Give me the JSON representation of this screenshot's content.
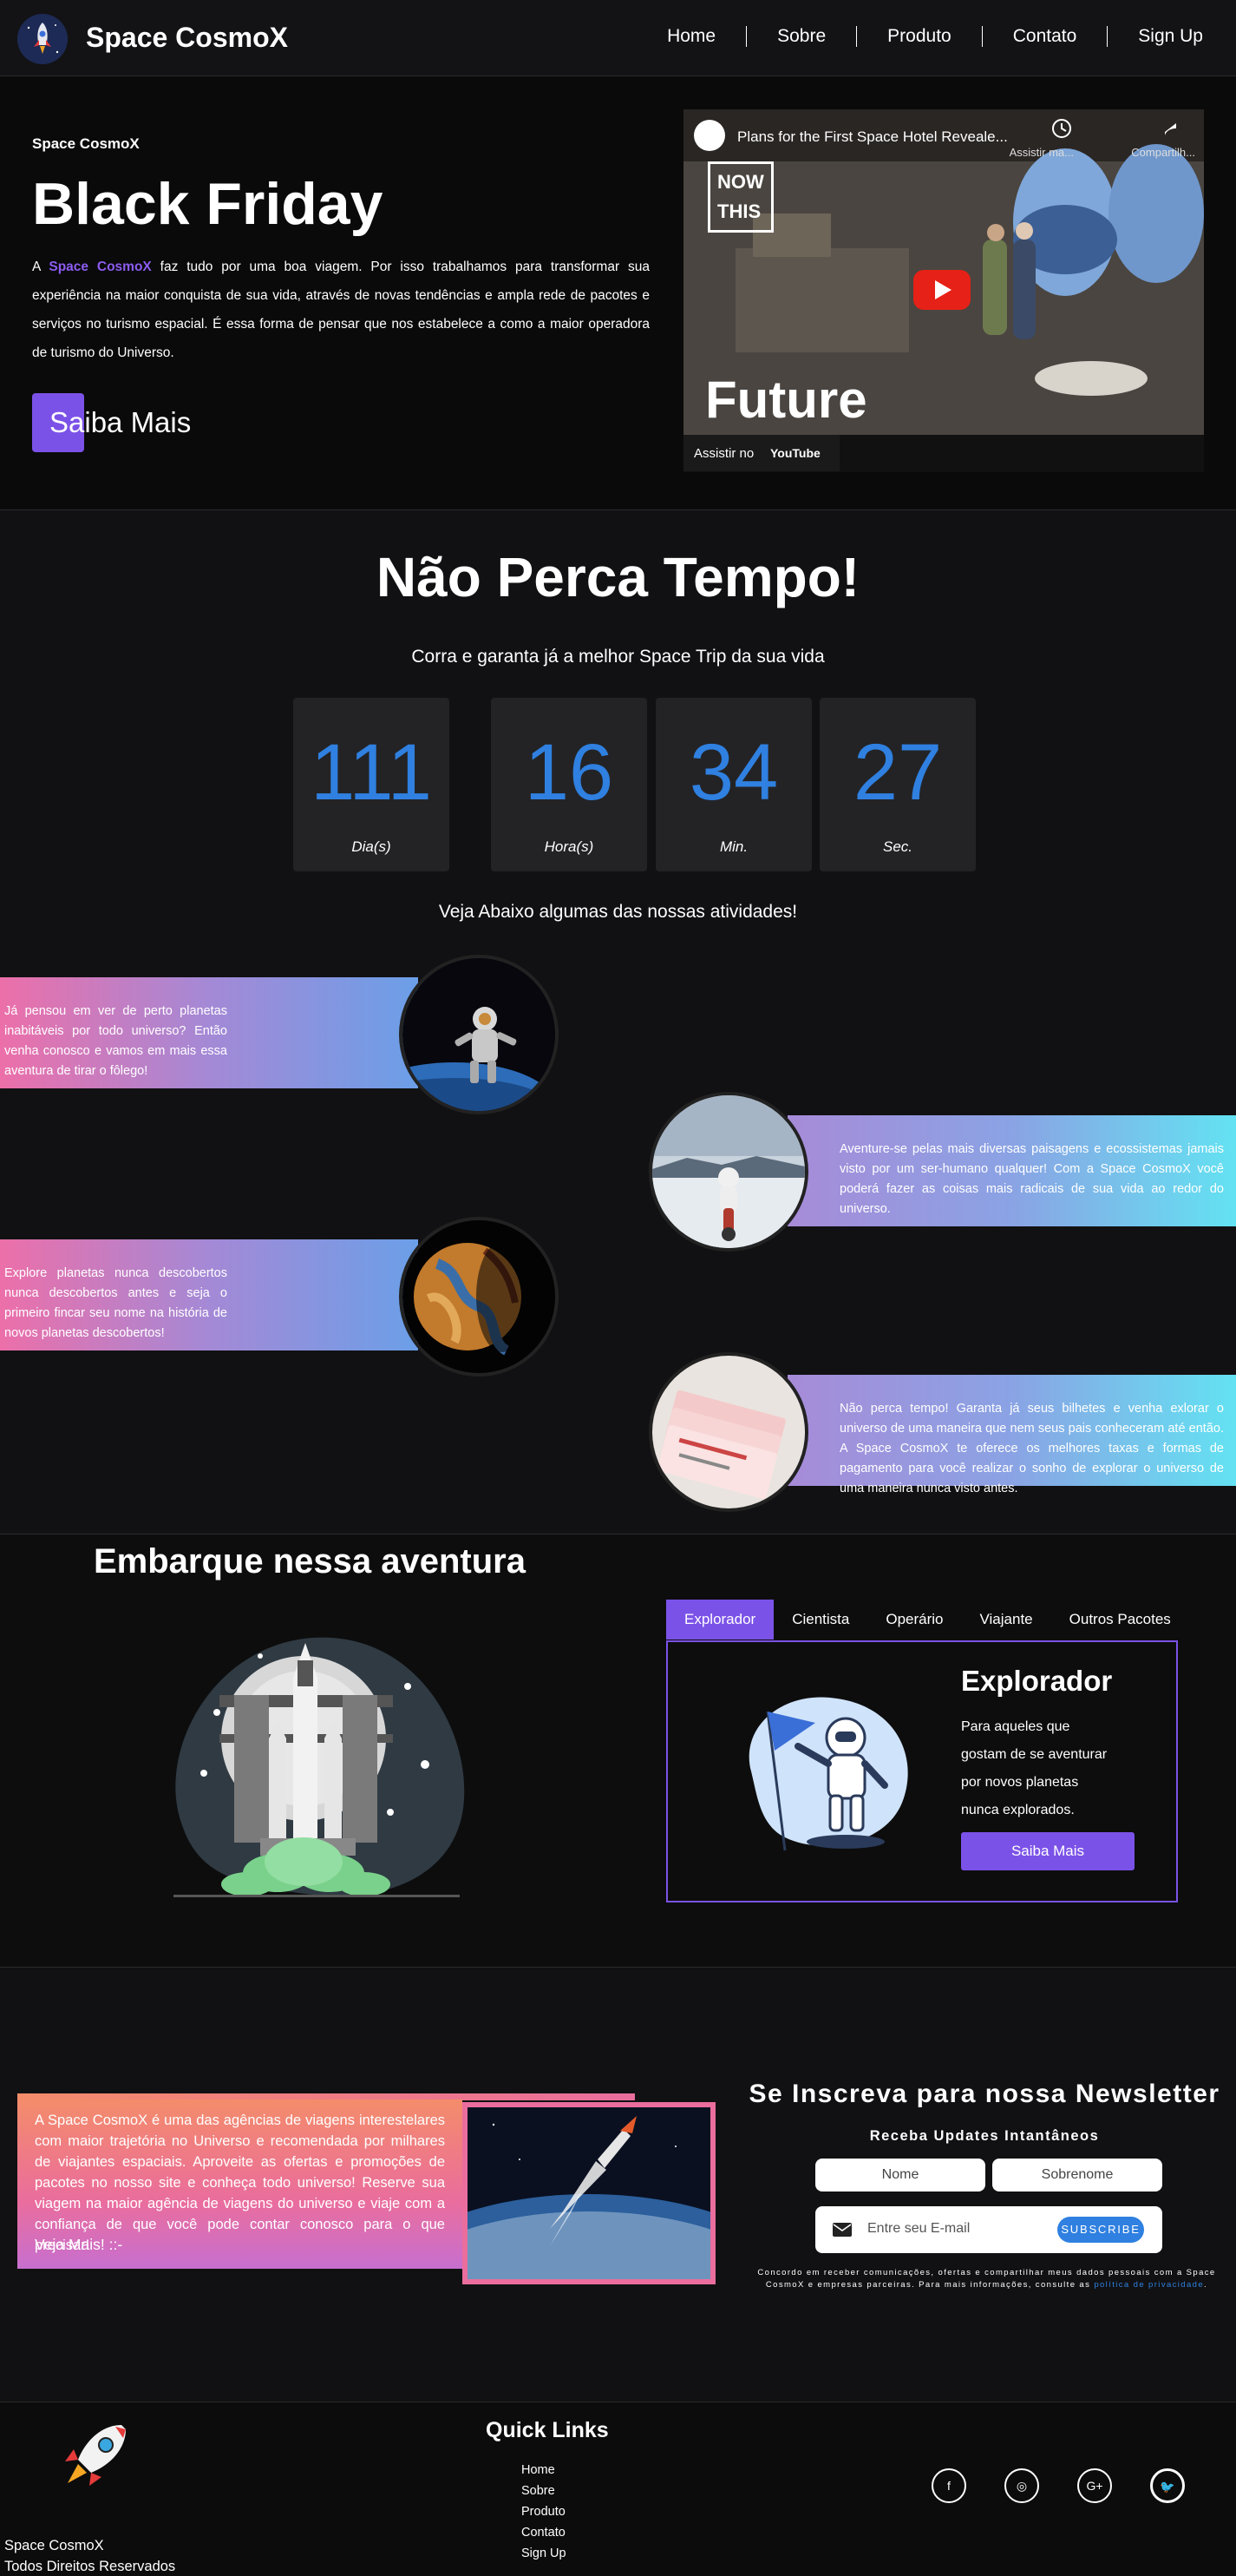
{
  "nav": {
    "brand": "Space CosmoX",
    "links": [
      "Home",
      "Sobre",
      "Produto",
      "Contato",
      "Sign Up"
    ]
  },
  "hero": {
    "kicker": "Space CosmoX",
    "title": "Black Friday",
    "text_prefix": "A ",
    "text_brand": "Space CosmoX",
    "text_body": " faz tudo por uma boa viagem. Por isso trabalhamos para transformar sua experiência na maior conquista de sua vida, através de novas tendências e ampla rede de pacotes e serviços no turismo espacial. É essa forma de pensar que nos estabelece a como a maior operadora de turismo do Universo.",
    "button": "Saiba Mais",
    "video": {
      "title": "Plans for the First Space Hotel Reveale...",
      "watch_later": "Assistir ma...",
      "share": "Compartilh...",
      "overlay_word": "Future",
      "channel_line1": "NOW",
      "channel_line2": "THIS",
      "watch_on": "Assistir no",
      "platform": "YouTube"
    }
  },
  "countdown": {
    "title": "Não Perca Tempo!",
    "subtitle": "Corra e garanta já a melhor Space Trip da sua vida",
    "units": [
      {
        "value": "111",
        "label": "Dia(s)"
      },
      {
        "value": "16",
        "label": "Hora(s)"
      },
      {
        "value": "34",
        "label": "Min."
      },
      {
        "value": "27",
        "label": "Sec."
      }
    ],
    "activities_intro": "Veja Abaixo algumas das nossas atividades!"
  },
  "activities": [
    "Já pensou em ver de perto planetas inabitáveis por todo universo? Então venha conosco e vamos em mais essa aventura de tirar o fôlego!",
    "Aventure-se pelas mais diversas paisagens e ecossistemas jamais visto por um ser-humano qualquer! Com a Space CosmoX você poderá fazer as coisas mais radicais de sua vida ao redor do universo.",
    "Explore planetas nunca descobertos nunca descobertos antes e seja o primeiro fincar seu nome na história de novos planetas descobertos!",
    "Não perca tempo! Garanta já seus bilhetes e venha exlorar o universo de uma maneira que nem seus pais conheceram até então. A Space CosmoX te oferece os melhores taxas e formas de pagamento para você realizar o sonho de explorar o universo de uma maneira nunca visto antes."
  ],
  "adventure": {
    "title": "Embarque nessa aventura",
    "tabs": [
      "Explorador",
      "Cientista",
      "Operário",
      "Viajante",
      "Outros Pacotes"
    ],
    "panel_title": "Explorador",
    "panel_text": "Para aqueles que gostam de se aventurar por novos planetas nunca explorados.",
    "panel_button": "Saiba Mais"
  },
  "about": {
    "text": "A Space CosmoX é uma das agências de viagens interestelares com maior trajetória no Universo e recomendada por milhares de viajantes espaciais. Aproveite as ofertas e promoções de pacotes no nosso site e conheça todo universo! Reserve sua viagem na maior agência de viagens do universo e viaje com a confiança de que você pode contar conosco para o que precisar!",
    "cta": "Veja Mais! ::-"
  },
  "newsletter": {
    "title": "Se Inscreva para nossa Newsletter",
    "subtitle": "Receba Updates Intantâneos",
    "name_placeholder": "Nome",
    "surname_placeholder": "Sobrenome",
    "email_placeholder": "Entre seu E-mail",
    "subscribe": "SUBSCRIBE",
    "legal": "Concordo em receber comunicações, ofertas e compartilhar meus dados pessoais com a Space CosmoX e empresas parceiras. Para mais informações, consulte as ",
    "legal_link": "política de privacidade",
    "legal_end": "."
  },
  "footer": {
    "brand": "Space CosmoX",
    "rights": "Todos Direitos Reservados",
    "quick_links_title": "Quick Links",
    "quick_links": [
      "Home",
      "Sobre",
      "Produto",
      "Contato",
      "Sign Up"
    ],
    "social": [
      "f",
      "◎",
      "G+",
      "🐦"
    ]
  },
  "colors": {
    "accent": "#7b52e8",
    "counter_blue": "#2f80e0",
    "background": "#111113"
  }
}
